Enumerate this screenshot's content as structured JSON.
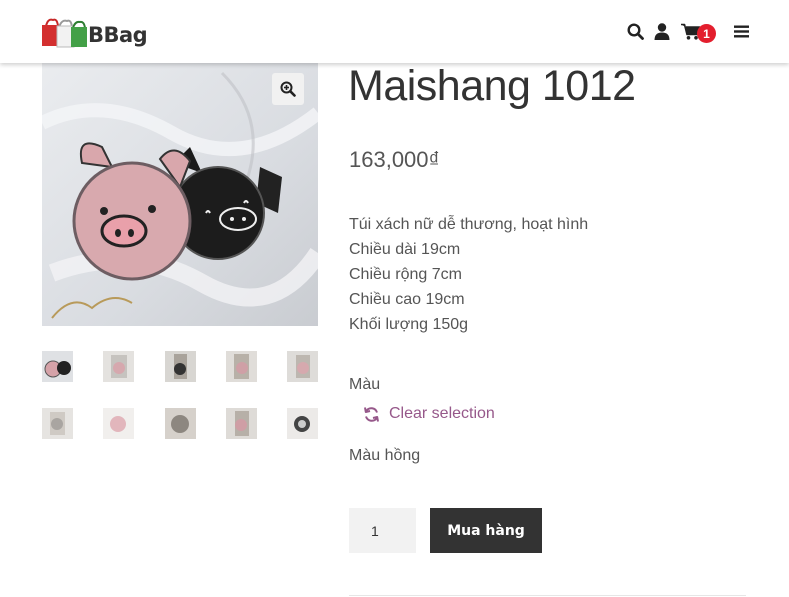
{
  "header": {
    "logo_text": "BBag",
    "cart_count": "1",
    "icons": [
      "search-icon",
      "user-icon",
      "cart-icon",
      "menu-icon"
    ]
  },
  "gallery": {
    "thumbnail_count": 10
  },
  "product": {
    "title": "Maishang 1012",
    "price": "163,000₫",
    "description_lines": [
      "Túi xách nữ dễ thương, hoạt hình",
      "Chiều dài 19cm",
      "Chiều rộng 7cm",
      "Chiều cao 19cm",
      "Khối lượng 150g"
    ],
    "attribute_label": "Màu",
    "clear_selection": "Clear selection",
    "selected_color": "Màu hồng",
    "quantity": "1",
    "buy_label": "Mua hàng"
  },
  "colors": {
    "accent": "#96588a",
    "badge": "#e31e2d",
    "button": "#333333"
  }
}
